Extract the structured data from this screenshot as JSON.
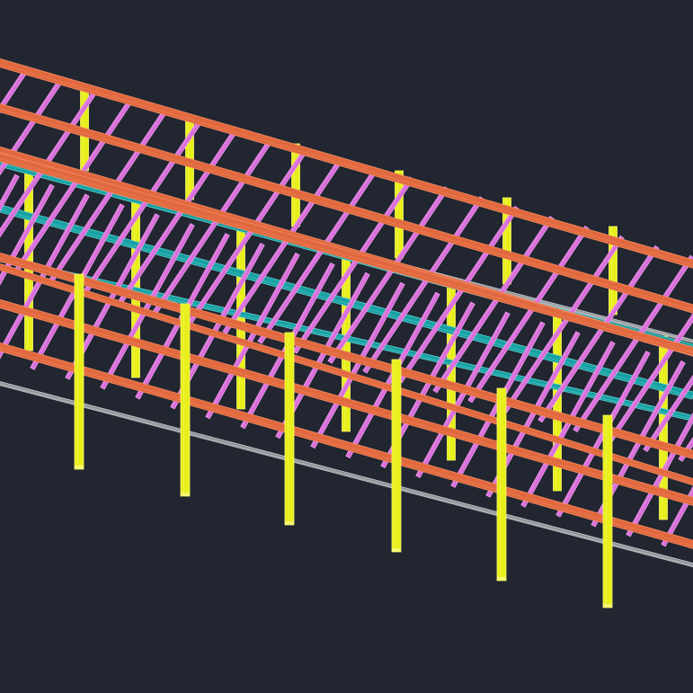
{
  "viewport": {
    "background_color": "#212630"
  },
  "structure": {
    "members": [
      {
        "type": "column",
        "color": "#e8ef1a",
        "edge_color": "#f6f870",
        "icon": "column-member"
      },
      {
        "type": "beam",
        "color": "#e2693f",
        "edge_color": "#f08a62",
        "icon": "beam-member"
      },
      {
        "type": "joist",
        "color": "#d66bd8",
        "edge_color": "#f29df0",
        "icon": "joist-member"
      },
      {
        "type": "girder",
        "color": "#18a1a3",
        "edge_color": "#5fd0d0",
        "icon": "girder-member"
      },
      {
        "type": "base-line",
        "color": "#8e9296",
        "edge_color": "#c7cacd",
        "icon": "ground-line"
      }
    ]
  }
}
